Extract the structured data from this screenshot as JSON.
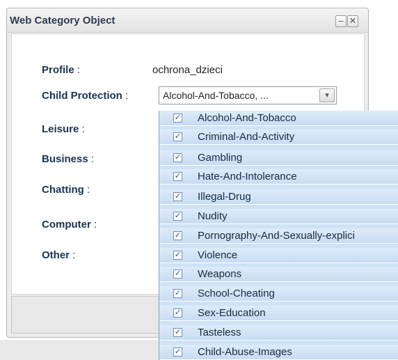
{
  "window": {
    "title": "Web Category Object",
    "minimize_glyph": "–",
    "close_glyph": "✕"
  },
  "form": {
    "profile": {
      "label": "Profile",
      "colon": " :",
      "value": "ochrona_dzieci"
    },
    "child_protection": {
      "label": "Child Protection",
      "colon": " :",
      "value": "Alcohol-And-Tobacco, ..."
    },
    "leisure": {
      "label": "Leisure",
      "colon": " :"
    },
    "business": {
      "label": "Business",
      "colon": " :"
    },
    "chatting": {
      "label": "Chatting",
      "colon": " :"
    },
    "computer": {
      "label": "Computer",
      "colon": " :"
    },
    "other": {
      "label": "Other",
      "colon": " :"
    }
  },
  "dropdown": {
    "check_glyph": "✓",
    "items": [
      {
        "label": "Alcohol-And-Tobacco",
        "checked": true
      },
      {
        "label": "Criminal-And-Activity",
        "checked": true
      },
      {
        "label": "Gambling",
        "checked": true
      },
      {
        "label": "Hate-And-Intolerance",
        "checked": true
      },
      {
        "label": "Illegal-Drug",
        "checked": true
      },
      {
        "label": "Nudity",
        "checked": true
      },
      {
        "label": "Pornography-And-Sexually-explici",
        "checked": true
      },
      {
        "label": "Violence",
        "checked": true
      },
      {
        "label": "Weapons",
        "checked": true
      },
      {
        "label": "School-Cheating",
        "checked": true
      },
      {
        "label": "Sex-Education",
        "checked": true
      },
      {
        "label": "Tasteless",
        "checked": true
      },
      {
        "label": "Child-Abuse-Images",
        "checked": true
      }
    ]
  },
  "colors": {
    "label": "#1a3352",
    "dropdown_bg": "#cfe3f7"
  },
  "icons": {
    "minimize": "minimize-icon",
    "close": "close-icon",
    "combo_arrow": "chevron-down-icon",
    "checkbox": "checkbox-checked-icon"
  }
}
